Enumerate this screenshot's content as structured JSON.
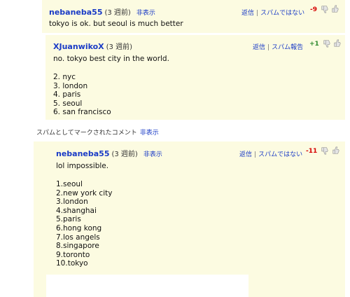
{
  "comment1": {
    "username": "nebaneba55",
    "age": "(3 週前)",
    "hide_label": "非表示",
    "reply_label": "返信",
    "spam_label": "スパムではない",
    "score": "-9",
    "text": "tokyo is ok. but seoul is much better"
  },
  "comment2": {
    "username": "XJuanwikoX",
    "age": "(3 週前)",
    "reply_label": "返信",
    "spam_label": "スパム報告",
    "score": "+1",
    "text": "no. tokyo best city in the world.",
    "list": [
      "2. nyc",
      "3. london",
      "4. paris",
      "5. seoul",
      "6. san francisco"
    ]
  },
  "spam_notice": {
    "text": "スパムとしてマークされたコメント",
    "hide_label": "非表示"
  },
  "comment3": {
    "username": "nebaneba55",
    "age": "(3 週前)",
    "hide_label": "非表示",
    "reply_label": "返信",
    "spam_label": "スパムではない",
    "score": "-11",
    "text": "lol impossible.",
    "list": [
      "1.seoul",
      "2.new york city",
      "3.london",
      "4.shanghai",
      "5.paris",
      "6.hong kong",
      "7.los angels",
      "8.singapore",
      "9.toronto",
      "10.tokyo"
    ]
  },
  "icons": {
    "thumb_down": "thumb-down-icon",
    "thumb_up": "thumb-up-icon"
  },
  "colors": {
    "comment_bg": "#fcfbe1",
    "link": "#1a3bc6",
    "negative": "#d60000",
    "positive": "#2e8a2e"
  }
}
